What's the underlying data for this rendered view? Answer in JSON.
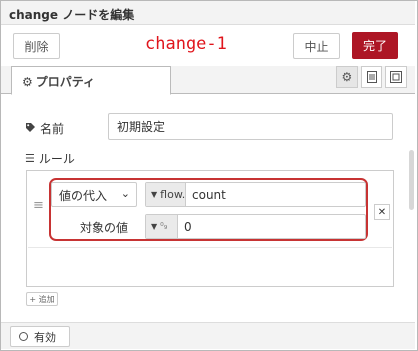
{
  "dialog": {
    "title": "change ノードを編集"
  },
  "toolbar": {
    "delete_label": "削除",
    "node_label": "change-1",
    "cancel_label": "中止",
    "done_label": "完了"
  },
  "tabs": {
    "properties_label": "プロパティ"
  },
  "form": {
    "name_label": "名前",
    "name_value": "初期設定",
    "rules_label": "ルール"
  },
  "rule": {
    "action": "値の代入",
    "target_type": "flow.",
    "target_value": "count",
    "value_label": "対象の値",
    "value_type": "0",
    "value": "0"
  },
  "add_label": "追加",
  "footer": {
    "enabled_label": "有効"
  },
  "colors": {
    "accent": "#ad1625",
    "highlight": "#c73333",
    "label_red": "#e0151c"
  }
}
